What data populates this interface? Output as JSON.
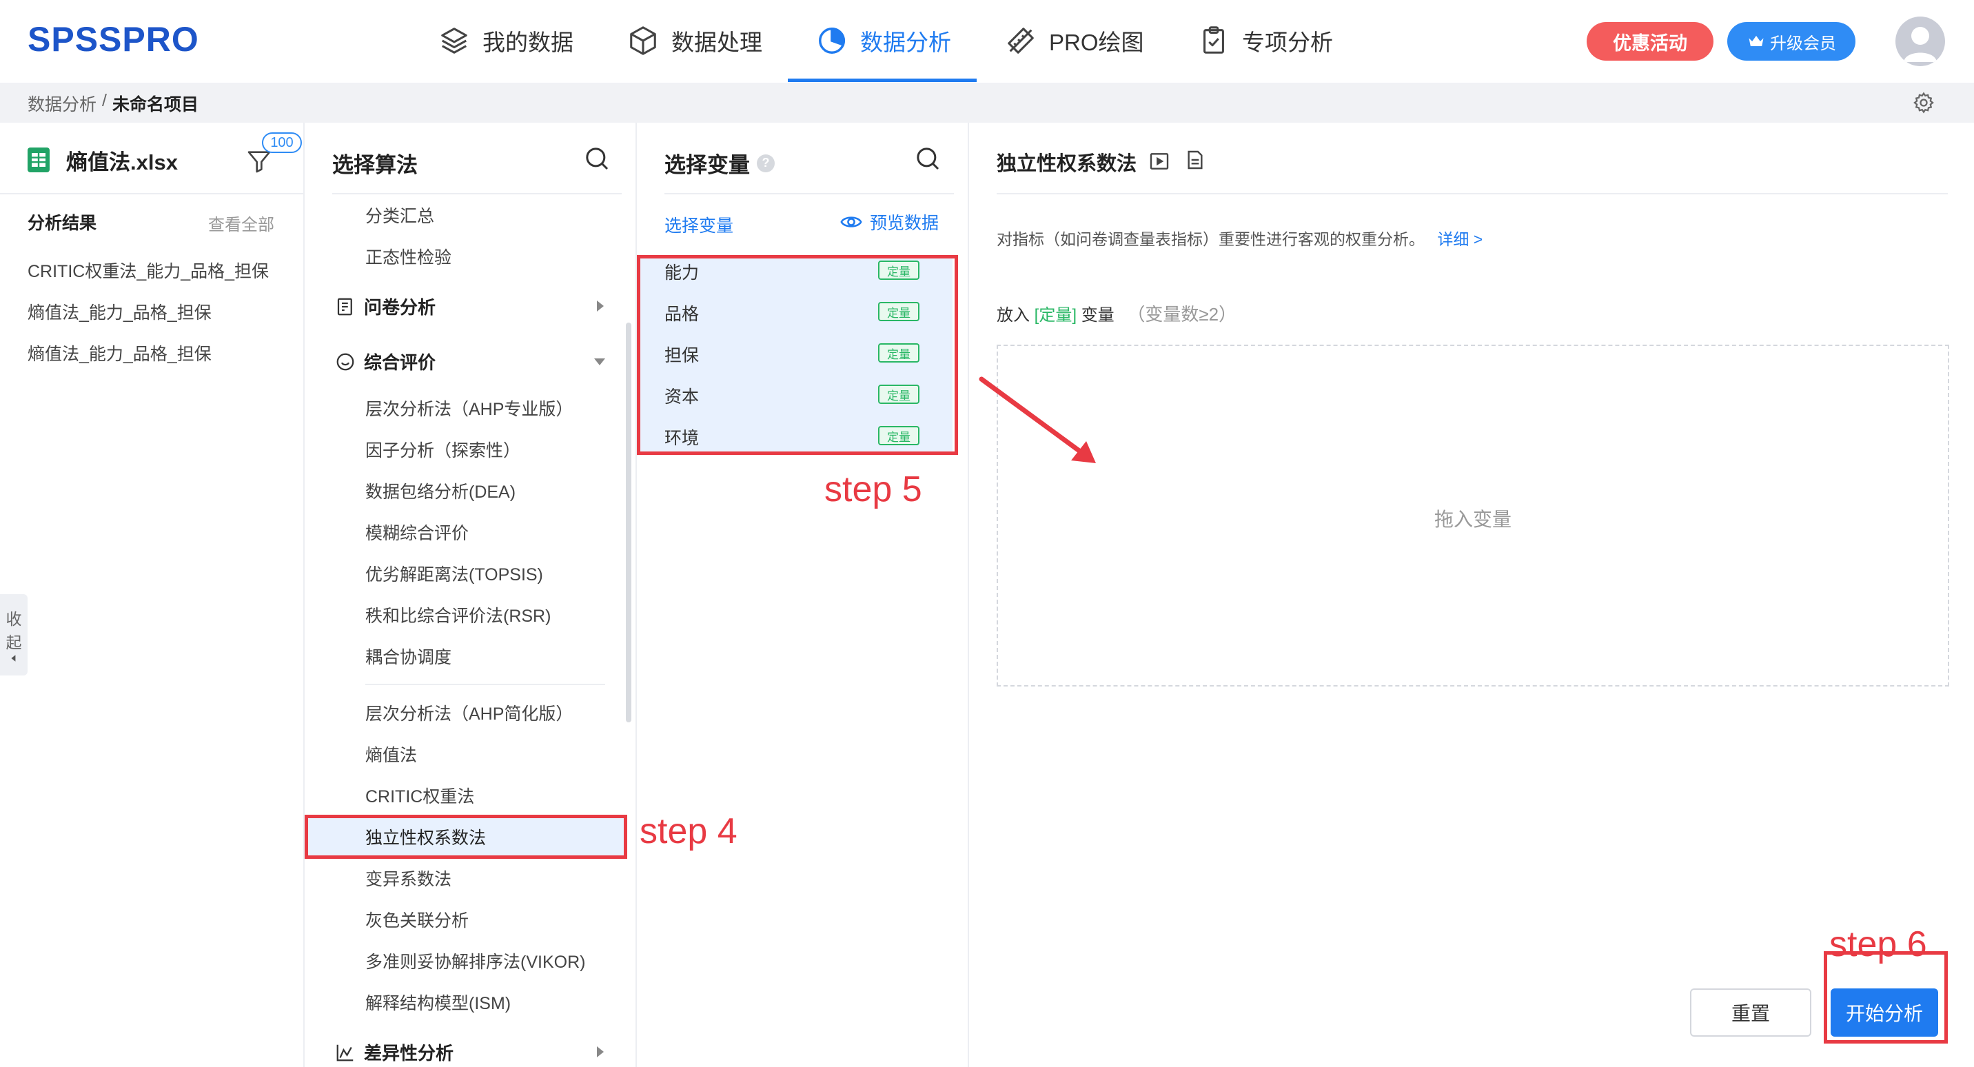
{
  "app": {
    "logo": "SPSSPRO"
  },
  "nav": {
    "items": [
      {
        "label": "我的数据",
        "icon": "layers-icon"
      },
      {
        "label": "数据处理",
        "icon": "cube-icon"
      },
      {
        "label": "数据分析",
        "icon": "pie-chart-icon",
        "active": true
      },
      {
        "label": "PRO绘图",
        "icon": "ruler-pencil-icon"
      },
      {
        "label": "专项分析",
        "icon": "clipboard-check-icon"
      }
    ],
    "promo": "优惠活动",
    "vip": "升级会员"
  },
  "breadcrumb": {
    "root": "数据分析",
    "sep": "/",
    "current": "未命名项目"
  },
  "file": {
    "name": "熵值法.xlsx",
    "filter_badge": "100",
    "results_title": "分析结果",
    "view_all": "查看全部",
    "results": [
      "CRITIC权重法_能力_品格_担保",
      "熵值法_能力_品格_担保",
      "熵值法_能力_品格_担保"
    ],
    "collapse": [
      "收",
      "起"
    ]
  },
  "algorithms": {
    "title": "选择算法",
    "top_items": [
      "分类汇总",
      "正态性检验"
    ],
    "groups": {
      "questionnaire": "问卷分析",
      "comprehensive": "综合评价",
      "difference": "差异性分析"
    },
    "comprehensive_items_a": [
      "层次分析法（AHP专业版）",
      "因子分析（探索性）",
      "数据包络分析(DEA)",
      "模糊综合评价",
      "优劣解距离法(TOPSIS)",
      "秩和比综合评价法(RSR)",
      "耦合协调度"
    ],
    "comprehensive_items_b": [
      "层次分析法（AHP简化版）",
      "熵值法",
      "CRITIC权重法",
      "独立性权系数法",
      "变异系数法",
      "灰色关联分析",
      "多准则妥协解排序法(VIKOR)",
      "解释结构模型(ISM)"
    ],
    "selected": "独立性权系数法"
  },
  "variables": {
    "title": "选择变量",
    "help": "?",
    "tab": "选择变量",
    "preview": "预览数据",
    "items": [
      {
        "name": "能力",
        "tag": "定量"
      },
      {
        "name": "品格",
        "tag": "定量"
      },
      {
        "name": "担保",
        "tag": "定量"
      },
      {
        "name": "资本",
        "tag": "定量"
      },
      {
        "name": "环境",
        "tag": "定量"
      }
    ]
  },
  "method": {
    "title": "独立性权系数法",
    "description": "对指标（如问卷调查量表指标）重要性进行客观的权重分析。",
    "detail_link": "详细 >",
    "drop_prefix": "放入",
    "drop_type": "[定量]",
    "drop_suffix": "变量",
    "drop_hint": "（变量数≥2）",
    "drop_placeholder": "拖入变量",
    "reset": "重置",
    "start": "开始分析"
  },
  "annotations": {
    "step4": "step 4",
    "step5": "step 5",
    "step6": "step 6"
  },
  "colors": {
    "accent": "#1f7bf0",
    "brand": "#1d55c9",
    "promo": "#f45c5c",
    "quantitative": "#29b765",
    "annotation": "#e83a43"
  }
}
